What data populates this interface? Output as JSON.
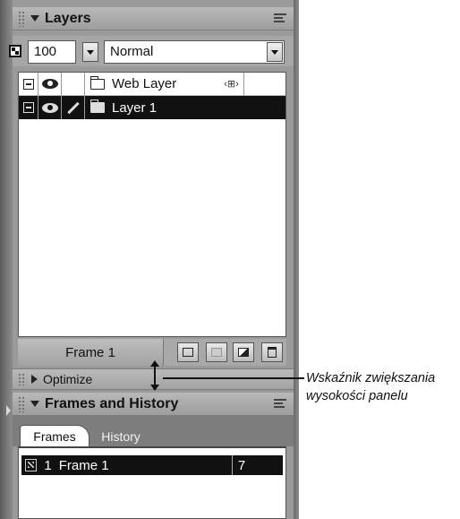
{
  "layers_panel": {
    "title": "Layers",
    "opacity": "100",
    "blend_mode": "Normal",
    "layers": [
      {
        "name": "Web Layer",
        "selected": false
      },
      {
        "name": "Layer 1",
        "selected": true
      }
    ],
    "frame_label": "Frame 1"
  },
  "optimize_panel": {
    "title": "Optimize"
  },
  "frames_history_panel": {
    "title": "Frames and History",
    "tabs": [
      {
        "label": "Frames",
        "active": true
      },
      {
        "label": "History",
        "active": false
      }
    ],
    "frames": [
      {
        "number": "1",
        "name": "Frame 1",
        "delay": "7"
      }
    ]
  },
  "callout": {
    "line1": "Wskaźnik zwiększania",
    "line2": "wysokości panelu"
  },
  "icons": {
    "panel_menu": "panel-menu-icon",
    "opacity": "opacity-icon",
    "eye": "eye-icon",
    "pencil": "pencil-icon",
    "folder": "folder-icon",
    "share": "share-icon",
    "new_layer": "new-layer-icon",
    "add_mask": "add-mask-icon",
    "duplicate": "duplicate-layer-icon",
    "trash": "trash-icon",
    "resize": "resize-vertical-icon"
  }
}
